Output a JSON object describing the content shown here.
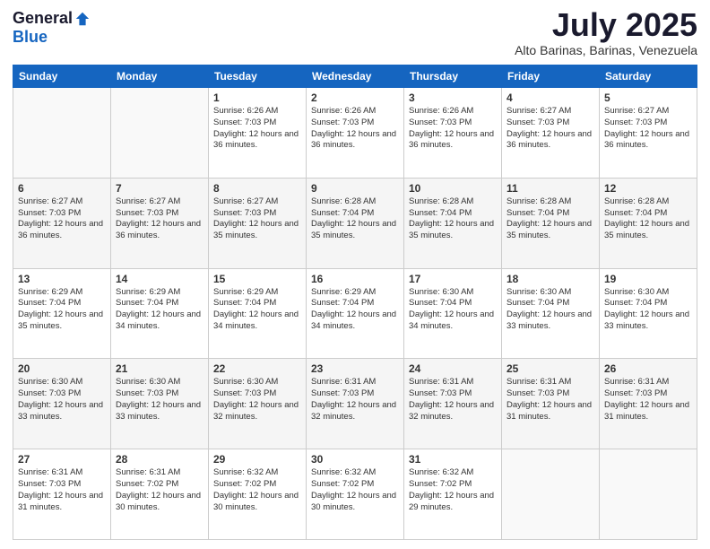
{
  "header": {
    "logo_general": "General",
    "logo_blue": "Blue",
    "month_title": "July 2025",
    "location": "Alto Barinas, Barinas, Venezuela"
  },
  "days_of_week": [
    "Sunday",
    "Monday",
    "Tuesday",
    "Wednesday",
    "Thursday",
    "Friday",
    "Saturday"
  ],
  "weeks": [
    [
      {
        "day": "",
        "info": ""
      },
      {
        "day": "",
        "info": ""
      },
      {
        "day": "1",
        "info": "Sunrise: 6:26 AM\nSunset: 7:03 PM\nDaylight: 12 hours and 36 minutes."
      },
      {
        "day": "2",
        "info": "Sunrise: 6:26 AM\nSunset: 7:03 PM\nDaylight: 12 hours and 36 minutes."
      },
      {
        "day": "3",
        "info": "Sunrise: 6:26 AM\nSunset: 7:03 PM\nDaylight: 12 hours and 36 minutes."
      },
      {
        "day": "4",
        "info": "Sunrise: 6:27 AM\nSunset: 7:03 PM\nDaylight: 12 hours and 36 minutes."
      },
      {
        "day": "5",
        "info": "Sunrise: 6:27 AM\nSunset: 7:03 PM\nDaylight: 12 hours and 36 minutes."
      }
    ],
    [
      {
        "day": "6",
        "info": "Sunrise: 6:27 AM\nSunset: 7:03 PM\nDaylight: 12 hours and 36 minutes."
      },
      {
        "day": "7",
        "info": "Sunrise: 6:27 AM\nSunset: 7:03 PM\nDaylight: 12 hours and 36 minutes."
      },
      {
        "day": "8",
        "info": "Sunrise: 6:27 AM\nSunset: 7:03 PM\nDaylight: 12 hours and 35 minutes."
      },
      {
        "day": "9",
        "info": "Sunrise: 6:28 AM\nSunset: 7:04 PM\nDaylight: 12 hours and 35 minutes."
      },
      {
        "day": "10",
        "info": "Sunrise: 6:28 AM\nSunset: 7:04 PM\nDaylight: 12 hours and 35 minutes."
      },
      {
        "day": "11",
        "info": "Sunrise: 6:28 AM\nSunset: 7:04 PM\nDaylight: 12 hours and 35 minutes."
      },
      {
        "day": "12",
        "info": "Sunrise: 6:28 AM\nSunset: 7:04 PM\nDaylight: 12 hours and 35 minutes."
      }
    ],
    [
      {
        "day": "13",
        "info": "Sunrise: 6:29 AM\nSunset: 7:04 PM\nDaylight: 12 hours and 35 minutes."
      },
      {
        "day": "14",
        "info": "Sunrise: 6:29 AM\nSunset: 7:04 PM\nDaylight: 12 hours and 34 minutes."
      },
      {
        "day": "15",
        "info": "Sunrise: 6:29 AM\nSunset: 7:04 PM\nDaylight: 12 hours and 34 minutes."
      },
      {
        "day": "16",
        "info": "Sunrise: 6:29 AM\nSunset: 7:04 PM\nDaylight: 12 hours and 34 minutes."
      },
      {
        "day": "17",
        "info": "Sunrise: 6:30 AM\nSunset: 7:04 PM\nDaylight: 12 hours and 34 minutes."
      },
      {
        "day": "18",
        "info": "Sunrise: 6:30 AM\nSunset: 7:04 PM\nDaylight: 12 hours and 33 minutes."
      },
      {
        "day": "19",
        "info": "Sunrise: 6:30 AM\nSunset: 7:04 PM\nDaylight: 12 hours and 33 minutes."
      }
    ],
    [
      {
        "day": "20",
        "info": "Sunrise: 6:30 AM\nSunset: 7:03 PM\nDaylight: 12 hours and 33 minutes."
      },
      {
        "day": "21",
        "info": "Sunrise: 6:30 AM\nSunset: 7:03 PM\nDaylight: 12 hours and 33 minutes."
      },
      {
        "day": "22",
        "info": "Sunrise: 6:30 AM\nSunset: 7:03 PM\nDaylight: 12 hours and 32 minutes."
      },
      {
        "day": "23",
        "info": "Sunrise: 6:31 AM\nSunset: 7:03 PM\nDaylight: 12 hours and 32 minutes."
      },
      {
        "day": "24",
        "info": "Sunrise: 6:31 AM\nSunset: 7:03 PM\nDaylight: 12 hours and 32 minutes."
      },
      {
        "day": "25",
        "info": "Sunrise: 6:31 AM\nSunset: 7:03 PM\nDaylight: 12 hours and 31 minutes."
      },
      {
        "day": "26",
        "info": "Sunrise: 6:31 AM\nSunset: 7:03 PM\nDaylight: 12 hours and 31 minutes."
      }
    ],
    [
      {
        "day": "27",
        "info": "Sunrise: 6:31 AM\nSunset: 7:03 PM\nDaylight: 12 hours and 31 minutes."
      },
      {
        "day": "28",
        "info": "Sunrise: 6:31 AM\nSunset: 7:02 PM\nDaylight: 12 hours and 30 minutes."
      },
      {
        "day": "29",
        "info": "Sunrise: 6:32 AM\nSunset: 7:02 PM\nDaylight: 12 hours and 30 minutes."
      },
      {
        "day": "30",
        "info": "Sunrise: 6:32 AM\nSunset: 7:02 PM\nDaylight: 12 hours and 30 minutes."
      },
      {
        "day": "31",
        "info": "Sunrise: 6:32 AM\nSunset: 7:02 PM\nDaylight: 12 hours and 29 minutes."
      },
      {
        "day": "",
        "info": ""
      },
      {
        "day": "",
        "info": ""
      }
    ]
  ]
}
